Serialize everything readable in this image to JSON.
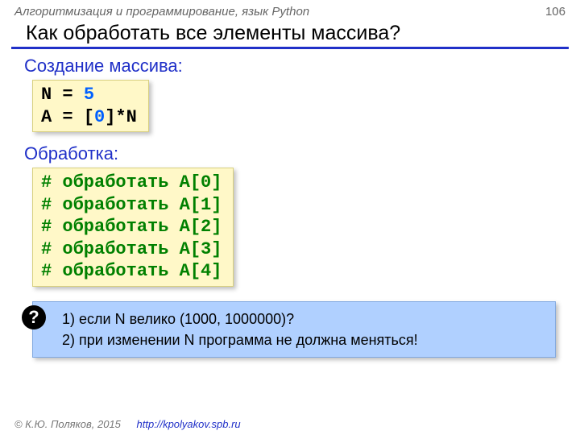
{
  "header": {
    "course": "Алгоритмизация и программирование, язык Python",
    "page": "106"
  },
  "title": "Как обработать все элементы массива?",
  "sections": {
    "create_label": "Создание массива:",
    "process_label": "Обработка:"
  },
  "code_create": {
    "l1_a": "N = ",
    "l1_num": "5",
    "l2_a": "A = [",
    "l2_num": "0",
    "l2_b": "]*N"
  },
  "code_process": {
    "c0": "# обработать A[0]",
    "c1": "# обработать A[1]",
    "c2": "# обработать A[2]",
    "c3": "# обработать A[3]",
    "c4": "# обработать A[4]"
  },
  "question": {
    "q1": "1) если N велико (1000, 1000000)?",
    "q2": "2) при изменении N программа не должна меняться!"
  },
  "footer": {
    "copyright": "© К.Ю. Поляков, 2015",
    "url": "http://kpolyakov.spb.ru"
  }
}
